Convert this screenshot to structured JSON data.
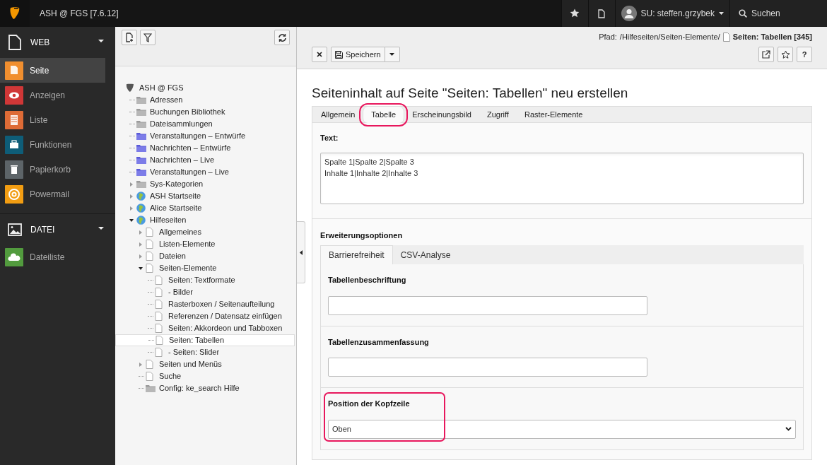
{
  "topbar": {
    "title": "ASH @ FGS [7.6.12]",
    "user": "SU: steffen.grzybek",
    "search": "Suchen"
  },
  "modules": [
    {
      "label": "WEB",
      "expanded": true,
      "items": [
        {
          "label": "Seite",
          "color": "#f18f2f",
          "kind": "page",
          "selected": true
        },
        {
          "label": "Anzeigen",
          "color": "#d03737",
          "kind": "eye",
          "selected": false
        },
        {
          "label": "Liste",
          "color": "#de6b36",
          "kind": "list",
          "selected": false
        },
        {
          "label": "Funktionen",
          "color": "#0e5d78",
          "kind": "case",
          "selected": false
        },
        {
          "label": "Papierkorb",
          "color": "#5d6468",
          "kind": "trash",
          "selected": false
        },
        {
          "label": "Powermail",
          "color": "#f29d12",
          "kind": "at",
          "selected": false
        }
      ]
    },
    {
      "label": "DATEI",
      "expanded": true,
      "items": [
        {
          "label": "Dateiliste",
          "color": "#529b3e",
          "kind": "cloud",
          "selected": false
        }
      ]
    }
  ],
  "tree": {
    "label": "ASH @ FGS",
    "kind": "root",
    "selected": false,
    "children": [
      {
        "label": "Adressen",
        "kind": "folder",
        "selected": false
      },
      {
        "label": "Buchungen Bibliothek",
        "kind": "folder",
        "selected": false
      },
      {
        "label": "Dateisammlungen",
        "kind": "folder",
        "selected": false
      },
      {
        "label": "Veranstaltungen – Entwürfe",
        "kind": "blue-folder",
        "selected": false
      },
      {
        "label": "Nachrichten – Entwürfe",
        "kind": "blue-folder",
        "selected": false
      },
      {
        "label": "Nachrichten – Live",
        "kind": "blue-folder",
        "selected": false
      },
      {
        "label": "Veranstaltungen – Live",
        "kind": "blue-folder",
        "selected": false
      },
      {
        "label": "Sys-Kategorien",
        "kind": "folder",
        "expanded": false,
        "selected": false
      },
      {
        "label": "ASH Startseite",
        "kind": "globe",
        "expanded": false,
        "selected": false
      },
      {
        "label": "Alice Startseite",
        "kind": "globe",
        "expanded": false,
        "selected": false
      },
      {
        "label": "Hilfeseiten",
        "kind": "globe",
        "expanded": true,
        "selected": false,
        "children": [
          {
            "label": "Allgemeines",
            "kind": "page",
            "expanded": false,
            "selected": false
          },
          {
            "label": "Listen-Elemente",
            "kind": "page",
            "expanded": false,
            "selected": false
          },
          {
            "label": "Dateien",
            "kind": "page",
            "expanded": false,
            "selected": false
          },
          {
            "label": "Seiten-Elemente",
            "kind": "page",
            "expanded": true,
            "selected": false,
            "children": [
              {
                "label": "Seiten: Textformate",
                "kind": "page",
                "selected": false
              },
              {
                "label": "- Bilder",
                "kind": "page",
                "selected": false
              },
              {
                "label": "Rasterboxen / Seitenaufteilung",
                "kind": "page",
                "selected": false
              },
              {
                "label": "Referenzen / Datensatz einfügen",
                "kind": "page",
                "selected": false
              },
              {
                "label": "Seiten: Akkordeon und Tabboxen",
                "kind": "page",
                "selected": false
              },
              {
                "label": "Seiten: Tabellen",
                "kind": "page",
                "selected": true
              },
              {
                "label": "- Seiten: Slider",
                "kind": "page",
                "selected": false
              }
            ]
          },
          {
            "label": "Seiten und Menüs",
            "kind": "page",
            "expanded": false,
            "selected": false
          },
          {
            "label": "Suche",
            "kind": "page",
            "selected": false
          },
          {
            "label": "Config: ke_search Hilfe",
            "kind": "folder",
            "selected": false
          }
        ]
      }
    ]
  },
  "path": {
    "label": "Pfad:",
    "value": "/Hilfeseiten/Seiten-Elemente/",
    "page": "Seiten: Tabellen [345]"
  },
  "buttons": {
    "save": "Speichern",
    "help": "?"
  },
  "heading": "Seiteninhalt auf Seite \"Seiten: Tabellen\" neu erstellen",
  "tabs": [
    {
      "label": "Allgemein",
      "selected": false,
      "highlighted": false
    },
    {
      "label": "Tabelle",
      "selected": true,
      "highlighted": true
    },
    {
      "label": "Erscheinungsbild",
      "selected": false,
      "highlighted": false
    },
    {
      "label": "Zugriff",
      "selected": false,
      "highlighted": false
    },
    {
      "label": "Raster-Elemente",
      "selected": false,
      "highlighted": false
    }
  ],
  "text_field": {
    "label": "Text:",
    "value": "Spalte 1|Spalte 2|Spalte 3\nInhalte 1|Inhalte 2|Inhalte 3"
  },
  "options": {
    "title": "Erweiterungsoptionen",
    "tabs": [
      {
        "label": "Barrierefreiheit",
        "selected": true
      },
      {
        "label": "CSV-Analyse",
        "selected": false
      }
    ],
    "fields": [
      {
        "label": "Tabellenbeschriftung",
        "kind": "input",
        "highlighted": false
      },
      {
        "label": "Tabellenzusammenfassung",
        "kind": "input",
        "highlighted": false
      },
      {
        "label": "Position der Kopfzeile",
        "kind": "select",
        "value": "Oben",
        "highlighted": true
      }
    ]
  }
}
